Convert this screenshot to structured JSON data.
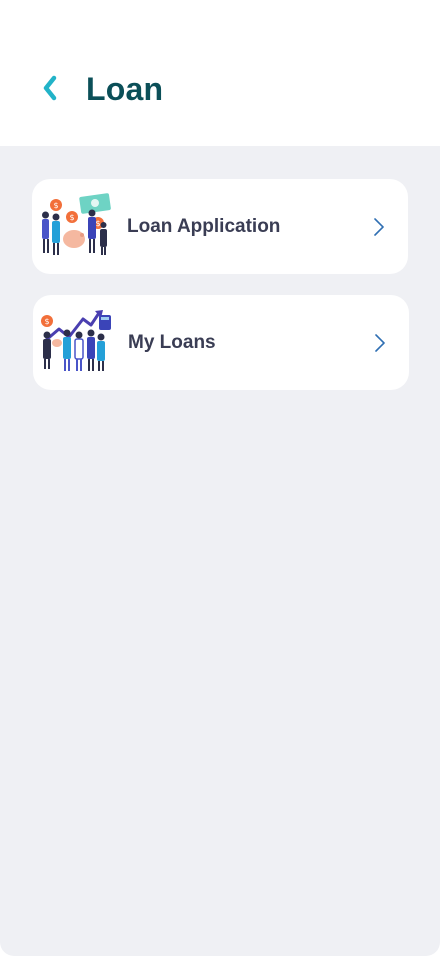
{
  "header": {
    "title": "Loan",
    "back_icon": "chevron-left-icon"
  },
  "menu": [
    {
      "label": "Loan Application",
      "icon": "loan-application-illustration"
    },
    {
      "label": "My Loans",
      "icon": "my-loans-illustration"
    }
  ],
  "colors": {
    "accent": "#22b3c8",
    "title": "#0b4f58",
    "label": "#3a3d54",
    "background": "#eff0f4",
    "card": "#ffffff",
    "chevron": "#2f6fb3"
  }
}
